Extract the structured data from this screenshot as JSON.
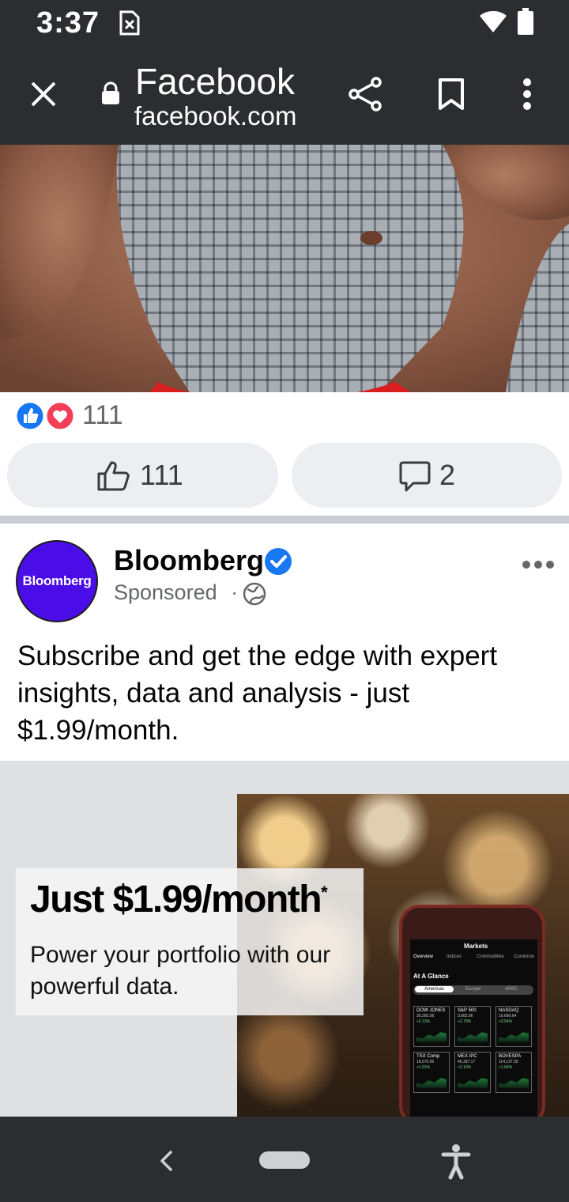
{
  "status_bar": {
    "time": "3:37"
  },
  "browser": {
    "title": "Facebook",
    "url": "facebook.com"
  },
  "post1": {
    "reaction_count": "111",
    "like_count": "111",
    "comment_count": "2"
  },
  "ad_post": {
    "avatar_text": "Bloomberg",
    "page_name": "Bloomberg",
    "sponsored_label": "Sponsored",
    "separator": "·",
    "body": "Subscribe and get the edge with expert insights, data and analysis - just $1.99/month.",
    "creative": {
      "headline": "Just $1.99/month",
      "asterisk": "*",
      "subline": "Power your portfolio with our powerful data.",
      "phone": {
        "header": "Markets",
        "tabs": [
          "Overview",
          "Indices",
          "Commodities",
          "Currencie"
        ],
        "section": "At A Glance",
        "regions": [
          "Americas",
          "Europe",
          "APAC"
        ],
        "tiles": [
          {
            "name": "DOW JONES",
            "value": "30,265.56",
            "change": "+2.13%"
          },
          {
            "name": "S&P 500",
            "value": "3,682.96",
            "change": "+2.79%"
          },
          {
            "name": "NASDAQ",
            "value": "10,666.64",
            "change": "+3.54%"
          },
          {
            "name": "TSX Comp",
            "value": "18,676.95",
            "change": "+1.91%"
          },
          {
            "name": "MEX IPC",
            "value": "46,397.17",
            "change": "+2.10%"
          },
          {
            "name": "BOVESPA",
            "value": "114,137.35",
            "change": "+1.64%"
          }
        ]
      }
    }
  },
  "colors": {
    "bars": "#2c2d31",
    "like_blue": "#1877f2",
    "love_red": "#f33e58",
    "bloomberg_purple": "#4a0de8",
    "verified_blue": "#1877f2"
  }
}
